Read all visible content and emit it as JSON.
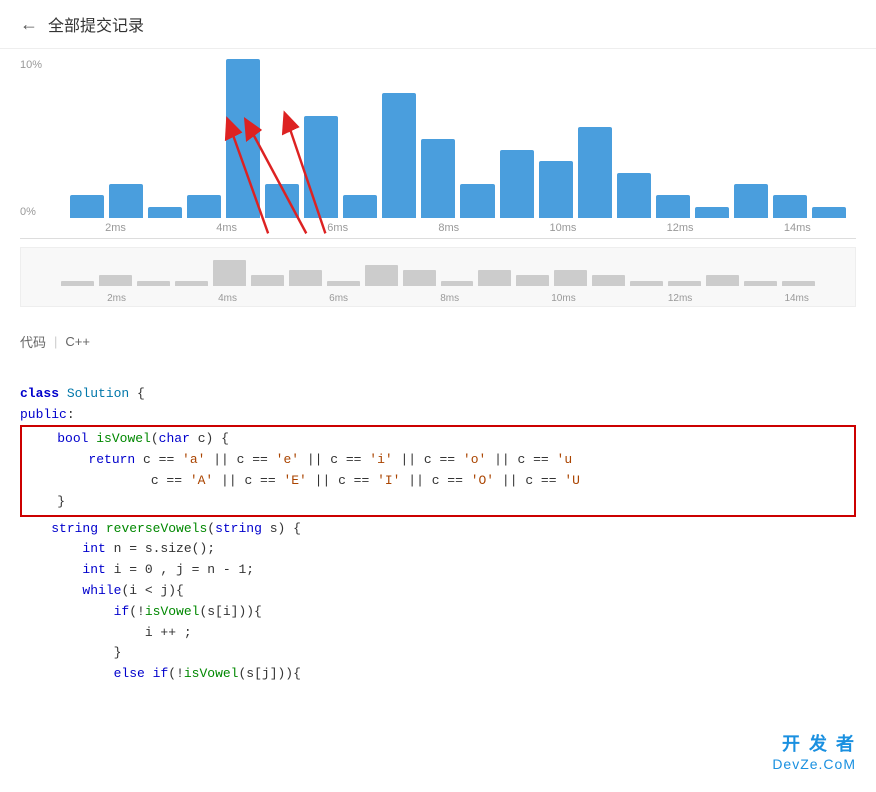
{
  "header": {
    "back_label": "←",
    "title": "全部提交记录"
  },
  "chart": {
    "y_labels": [
      "10%",
      "0%"
    ],
    "x_labels": [
      "2ms",
      "4ms",
      "6ms",
      "8ms",
      "10ms",
      "12ms",
      "14ms"
    ],
    "bars": [
      2,
      3,
      1,
      2,
      14,
      4,
      9,
      2,
      11,
      7,
      3,
      6,
      5,
      8,
      4,
      2,
      1,
      3,
      2,
      1
    ],
    "mini_bars": [
      2,
      3,
      1,
      2,
      8,
      4,
      5,
      2,
      6,
      4,
      2,
      4,
      3,
      5,
      2,
      1,
      1,
      2,
      1,
      1
    ]
  },
  "code_section": {
    "label": "代码",
    "language": "C++",
    "lines": [
      "class Solution {",
      "public:",
      "    bool isVowel(char c) {",
      "        return c == 'a' || c == 'e' || c == 'i' || c == 'o' || c == 'u",
      "                c == 'A' || c == 'E' || c == 'I' || c == 'O' || c == 'U",
      "    }",
      "    string reverseVowels(string s) {",
      "        int n = s.size();",
      "        int i = 0 , j = n - 1;",
      "        while(i < j){",
      "            if(!isVowel(s[i])){",
      "                i ++ ;",
      "            }",
      "            else if(!isVowel(s[j])){"
    ]
  },
  "watermark": {
    "top": "开 发 者",
    "bottom": "DevZe.CoM"
  }
}
